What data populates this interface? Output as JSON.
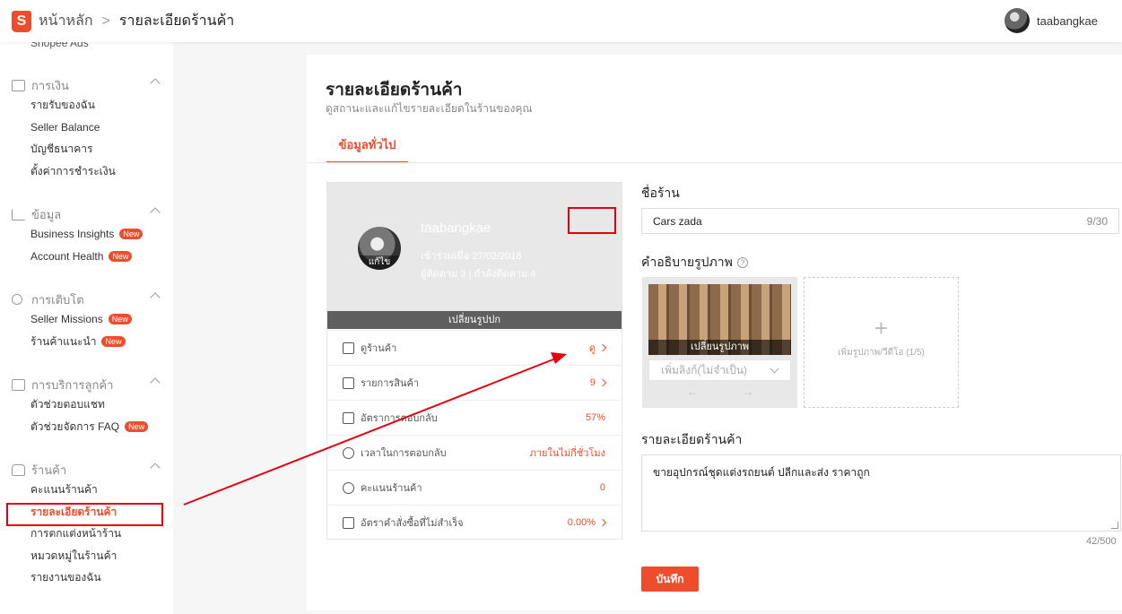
{
  "topbar": {
    "logo_letter": "S",
    "breadcrumb_home": "หน้าหลัก",
    "breadcrumb_sep": ">",
    "breadcrumb_current": "รายละเอียดร้านค้า",
    "username": "taabangkae"
  },
  "sidebar": {
    "top_cut_label": "Shopee Ads",
    "groups": [
      {
        "title": "การเงิน",
        "items": [
          {
            "label": "รายรับของฉัน"
          },
          {
            "label": "Seller Balance"
          },
          {
            "label": "บัญชีธนาคาร"
          },
          {
            "label": "ตั้งค่าการชำระเงิน"
          }
        ]
      },
      {
        "title": "ข้อมูล",
        "items": [
          {
            "label": "Business Insights",
            "badge": "New"
          },
          {
            "label": "Account Health",
            "badge": "New"
          }
        ]
      },
      {
        "title": "การเติบโต",
        "items": [
          {
            "label": "Seller Missions",
            "badge": "New"
          },
          {
            "label": "ร้านค้าแนะนำ",
            "badge": "New"
          }
        ]
      },
      {
        "title": "การบริการลูกค้า",
        "items": [
          {
            "label": "ตัวช่วยตอบแชท"
          },
          {
            "label": "ตัวช่วยจัดการ FAQ",
            "badge": "New"
          }
        ]
      },
      {
        "title": "ร้านค้า",
        "items": [
          {
            "label": "คะแนนร้านค้า"
          },
          {
            "label": "รายละเอียดร้านค้า",
            "active": true
          },
          {
            "label": "การตกแต่งหน้าร้าน"
          },
          {
            "label": "หมวดหมู่ในร้านค้า"
          },
          {
            "label": "รายงานของฉัน"
          }
        ]
      }
    ]
  },
  "main": {
    "title": "รายละเอียดร้านค้า",
    "subtitle": "ดูสถานะและแก้ไขรายละเอียดในร้านของคุณ",
    "tab": "ข้อมูลทั่วไป"
  },
  "profile": {
    "shop_user": "taabangkae",
    "joined": "เข้าร่วมเมื่อ 27/02/2018",
    "follow": "ผู้ติดตาม 3  |  กำลังติดตาม 4",
    "avatar_edit": "แก้ไข",
    "change_cover": "เปลี่ยนรูปปก",
    "stats": [
      {
        "label": "ดูร้านค้า",
        "value": "ดู",
        "chevron": true,
        "icon": "monitor-icon"
      },
      {
        "label": "รายการสินค้า",
        "value": "9",
        "chevron": true,
        "icon": "product-list-icon"
      },
      {
        "label": "อัตราการตอบกลับ",
        "value": "57%",
        "chevron": false,
        "icon": "chat-icon"
      },
      {
        "label": "เวลาในการตอบกลับ",
        "value": "ภายในไม่กี่ชั่วโมง",
        "chevron": false,
        "icon": "clock-icon"
      },
      {
        "label": "คะแนนร้านค้า",
        "value": "0",
        "chevron": false,
        "icon": "star-icon"
      },
      {
        "label": "อัตราคำสั่งซื้อที่ไม่สำเร็จ",
        "value": "0.00%",
        "chevron": true,
        "icon": "clipboard-icon"
      }
    ]
  },
  "form": {
    "shop_name_label": "ชื่อร้าน",
    "shop_name_value": "Cars zada",
    "shop_name_count": "9/30",
    "image_desc_label": "คำอธิบายรูปภาพ",
    "help_glyph": "?",
    "change_image": "เปลี่ยนรูปภาพ",
    "link_placeholder": "เพิ่มลิงก์(ไม่จำเป็น)",
    "arrow_left": "←",
    "arrow_right": "→",
    "add_plus": "+",
    "add_media": "เพิ่มรูปภาพ/วีดีโอ (1/5)",
    "shop_desc_label": "รายละเอียดร้านค้า",
    "shop_desc_value": "ขายอุปกรณ์ชุดแต่งรถยนต์ ปลีกและส่ง ราคาถูก",
    "shop_desc_count": "42/500",
    "save": "บันทึก"
  },
  "colors": {
    "accent": "#ee4d2d",
    "annotation": "#e4000f"
  }
}
